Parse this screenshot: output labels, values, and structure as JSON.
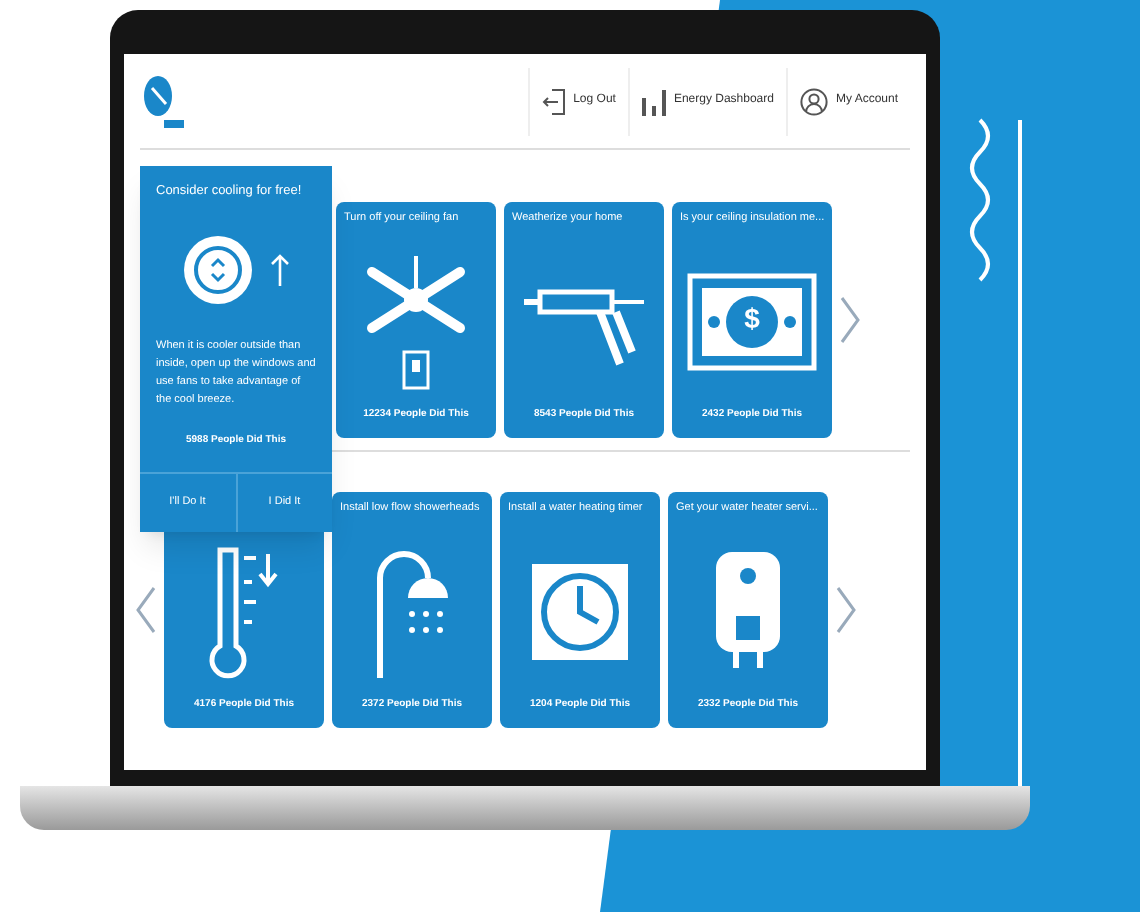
{
  "header": {
    "nav": [
      {
        "label": "Log Out"
      },
      {
        "label": "Energy Dashboard"
      },
      {
        "label": "My Account"
      }
    ]
  },
  "popup": {
    "title": "Consider cooling for free!",
    "body": "When it is cooler outside than inside, open up the windows and use fans to take advantage of the cool breeze.",
    "count": "5988 People Did This",
    "actions": [
      {
        "label": "I'll Do It"
      },
      {
        "label": "I Did It"
      }
    ]
  },
  "rows": [
    {
      "cards": [
        {
          "title": "Turn off your ceiling fan",
          "count": "12234 People Did This"
        },
        {
          "title": "Weatherize your home",
          "count": "8543 People Did This"
        },
        {
          "title": "Is your ceiling insulation me...",
          "symbol": "$",
          "count": "2432 People Did This"
        }
      ]
    },
    {
      "cards": [
        {
          "count": "4176 People Did This"
        },
        {
          "title": "Install low flow showerheads",
          "count": "2372 People Did This"
        },
        {
          "title": "Install a water heating timer",
          "count": "1204 People Did This"
        },
        {
          "title": "Get your water heater servi...",
          "count": "2332 People Did This"
        }
      ]
    }
  ]
}
